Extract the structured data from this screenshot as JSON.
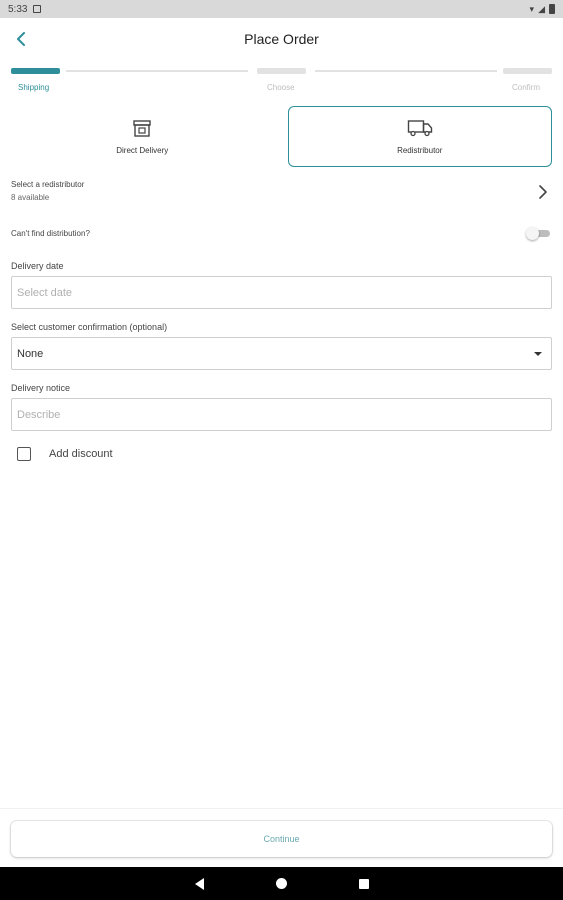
{
  "status_bar": {
    "time": "5:33"
  },
  "header": {
    "title": "Place Order"
  },
  "stepper": {
    "steps": [
      {
        "label": "Shipping",
        "active": true
      },
      {
        "label": "Choose",
        "active": false
      },
      {
        "label": "Confirm",
        "active": false
      }
    ]
  },
  "delivery_options": [
    {
      "label": "Direct Delivery",
      "icon": "store-icon",
      "selected": false
    },
    {
      "label": "Redistributor",
      "icon": "truck-icon",
      "selected": true
    }
  ],
  "redistributor": {
    "title": "Select a redistributor",
    "subtitle": "8 available"
  },
  "cant_find": {
    "label": "Can't find distribution?",
    "enabled": false
  },
  "delivery_date": {
    "label": "Delivery date",
    "placeholder": "Select date"
  },
  "customer_confirmation": {
    "label": "Select customer confirmation (optional)",
    "value": "None"
  },
  "delivery_notice": {
    "label": "Delivery notice",
    "placeholder": "Describe"
  },
  "discount": {
    "label": "Add discount",
    "checked": false
  },
  "footer": {
    "continue_label": "Continue"
  },
  "colors": {
    "accent": "#2e8f9a",
    "inactive_step": "#e2e2e2"
  }
}
